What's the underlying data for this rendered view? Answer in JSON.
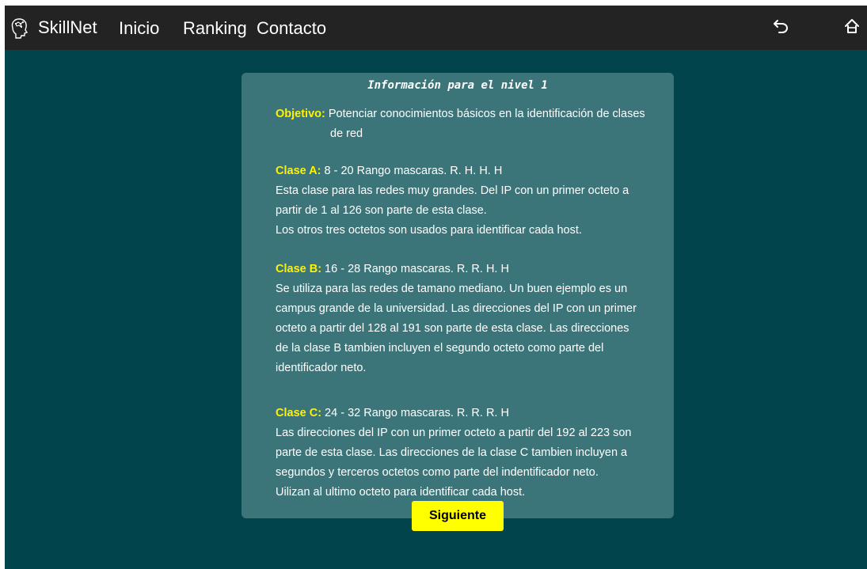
{
  "navbar": {
    "brand": "SkillNet",
    "links": [
      "Inicio",
      "Ranking",
      "Contacto"
    ],
    "icons": {
      "logo": "brain-head-icon",
      "back": "back-arrow-icon",
      "home": "home-icon"
    }
  },
  "card": {
    "title": "Información para el nivel 1",
    "objetivo": {
      "label": "Objetivo:",
      "text": "Potenciar conocimientos básicos en la identificación de clases de red"
    },
    "clase_a": {
      "label": "Clase A:",
      "heading": " 8 - 20 Rango mascaras. R. H. H. H",
      "lines": [
        "Esta clase para las redes muy grandes. Del IP con un primer octeto a",
        "partir de 1 al 126 son parte de esta clase.",
        "Los otros tres octetos son usados para identificar cada host."
      ]
    },
    "clase_b": {
      "label": "Clase B:",
      "heading": " 16 - 28 Rango mascaras. R. R. H. H",
      "lines": [
        "Se utiliza para las redes de tamano mediano. Un buen ejemplo es un",
        "campus grande de la universidad. Las direcciones del IP con un primer",
        "octeto a partir del 128 al 191 son parte de esta clase. Las direcciones",
        "de la clase B tambien incluyen el segundo octeto como parte del",
        "identificador neto."
      ]
    },
    "clase_c": {
      "label": "Clase C:",
      "heading": " 24 - 32 Rango mascaras. R. R. R. H",
      "lines": [
        "Las direcciones del IP con un primer octeto a partir del 192 al 223 son",
        "parte de esta clase. Las direcciones de la clase C tambien incluyen a",
        "segundos y terceros octetos como parte del indentificador neto.",
        "Uilizan al ultimo octeto para identificar cada host."
      ]
    }
  },
  "next_button": "Siguiente",
  "colors": {
    "background": "#02444c",
    "navbar": "#232323",
    "card": "#3c7579",
    "label": "#fff200",
    "button": "#ffff00"
  }
}
